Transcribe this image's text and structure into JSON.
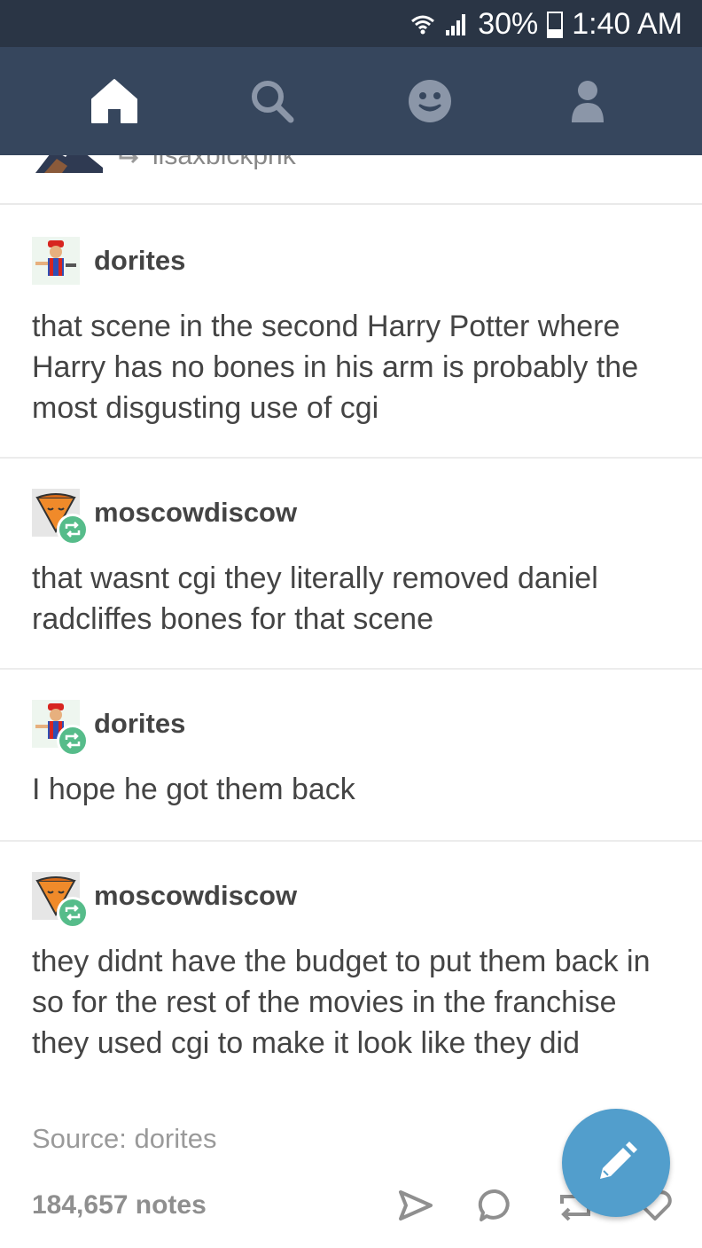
{
  "status_bar": {
    "battery": "30%",
    "time": "1:40 AM",
    "icons": [
      "wifi-icon",
      "signal-icon",
      "battery-icon"
    ]
  },
  "nav": {
    "items": [
      {
        "name": "home",
        "icon": "home-icon"
      },
      {
        "name": "search",
        "icon": "search-icon"
      },
      {
        "name": "activity",
        "icon": "smiley-icon"
      },
      {
        "name": "account",
        "icon": "person-icon"
      }
    ]
  },
  "previous_post": {
    "username": "lisaxbickpnk"
  },
  "thread": [
    {
      "username": "dorites",
      "reblog": false,
      "text": "that scene in the second Harry Potter where Harry has no bones in his arm is probably the most disgusting use of cgi"
    },
    {
      "username": "moscowdiscow",
      "reblog": true,
      "text": "that wasnt cgi they literally removed daniel radcliffes bones for that scene"
    },
    {
      "username": "dorites",
      "reblog": true,
      "text": "I hope he got them back"
    },
    {
      "username": "moscowdiscow",
      "reblog": true,
      "text": "they didnt have the budget to put them back in so for the rest of the movies in the franchise they used cgi to make it look like they did"
    }
  ],
  "footer": {
    "source": "Source: dorites",
    "notes": "184,657 notes"
  },
  "colors": {
    "status_bar": "#2a3545",
    "nav_bar": "#36465d",
    "reblog_green": "#56bc8a",
    "fab_blue": "#529ecc"
  }
}
